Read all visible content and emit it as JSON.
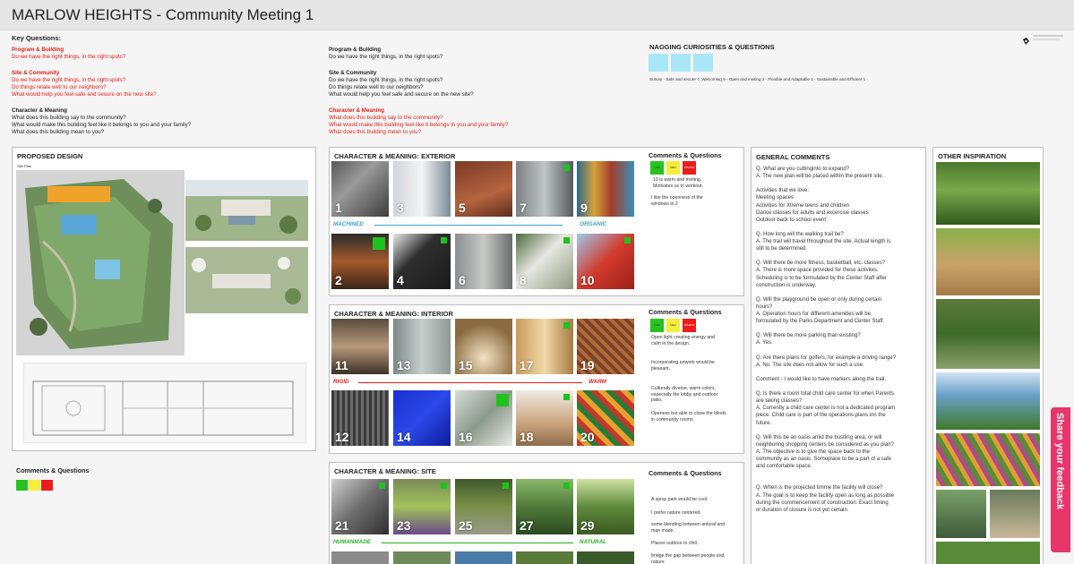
{
  "title": "MARLOW HEIGHTS - Community Meeting 1",
  "key_questions": {
    "heading": "Key Questions:",
    "program_heading": "Program & Building",
    "program_q": "Do we have the right things, in the right spots?",
    "site_heading": "Site & Community",
    "site_q1": "Do we have the right things, in the right spots?",
    "site_q2": "Do things relate well to our neighbors?",
    "site_q3": "What would help you feel safe and secure on the new site?",
    "char_heading": "Character & Meaning",
    "char_q1": "What does this building say to the community?",
    "char_q2": "What would make this building feel like it belongs to you and your family?",
    "char_q3": "What does this building mean to you?"
  },
  "nagging": {
    "heading": "NAGGING CURIOSITIES & QUESTIONS",
    "survey": "Survey - Safe and secure 7, Welcoming 5 - Open and inviting 2 - Flexible and Adaptable 1 - Sustainable and Efficient 1 -"
  },
  "proposed": {
    "heading": "PROPOSED DESIGN",
    "sublabel": "Site Plan",
    "comments_heading": "Comments & Questions"
  },
  "exterior": {
    "heading": "CHARACTER & MEANING: EXTERIOR",
    "left_label": "MACHINED",
    "right_label": "ORGANIC",
    "numbers": [
      "1",
      "3",
      "5",
      "7",
      "9",
      "2",
      "4",
      "6",
      "8",
      "10"
    ],
    "cq_heading": "Comments & Questions",
    "vote_labels": [
      "LIKE",
      "MEH",
      "DISLIKE"
    ],
    "comments": [
      "10 is warm and inviting. Motivates us to workout.",
      "I like the openness of the windows in 2"
    ]
  },
  "interior": {
    "heading": "CHARACTER & MEANING: INTERIOR",
    "left_label": "RIGID",
    "right_label": "WARM",
    "numbers": [
      "11",
      "13",
      "15",
      "17",
      "19",
      "12",
      "14",
      "16",
      "18",
      "20"
    ],
    "cq_heading": "Comments & Questions",
    "vote_labels": [
      "LIKE",
      "MEH",
      "DISLIKE"
    ],
    "comments": [
      "Open light creating energy and calm in the design.",
      "Incorporating artwork would be pleasant.",
      "Culturally diverse, warm colors, especially the lobby and outdoor patio.",
      "Openess but able to close the blinds in community rooms."
    ]
  },
  "site": {
    "heading": "CHARACTER & MEANING: SITE",
    "left_label": "HUMANMADE",
    "right_label": "NATURAL",
    "numbers": [
      "21",
      "23",
      "25",
      "27",
      "29"
    ],
    "cq_heading": "Comments & Questions",
    "comments": [
      "A spray park would be cool.",
      "I prefer nature centered.",
      "some blending between antural and man made.",
      "Places outdoor to chill.",
      "bridge the gap between people and nature"
    ]
  },
  "general": {
    "heading": "GENERAL COMMENTS",
    "lines": [
      "Q. What are you cuttinginto to expand?",
      "A.  The new plan will be placed within the present site.",
      "",
      "Activities that we love:",
      "Meeting spaces",
      "Activities for Xtreme teens and children",
      "Dance classes for adults and excercise classes",
      "Outdoor back to school event",
      "",
      "Q. How long will the walking trail be?",
      "A. The trail will travel throughout the site.  Actual length is",
      "still to be determined.",
      "",
      "Q. Will there be more fitness, basketball, etc. classes?",
      "A.  There is more space provided for these activites.",
      "  Scheduling is to be formulated by the Center Staff after",
      "construction is underway.",
      "",
      "Q.  Will the playground be open or only during certain",
      "hours?",
      "A.  Operation hours for different amenities will be",
      "formulated by the Parks Department and Center Staff.",
      "",
      "Q. Will there be more parking than existing?",
      "A. Yes.",
      "",
      "Q.  Are there plans for golfers, for example a driving range?",
      "A. No.  The site does not allow for such a use.",
      "",
      "Comment - I would like to have markers along the trail.",
      "",
      "Q. Is there a room total child care center for when Parents",
      "are taking classes?",
      "A. Currently a child care center is not a dedicated program",
      "piece.  Child care is part of the operations plans inn the",
      "future.",
      "",
      "Q. Will this be an oasis amid the bustling area, or will",
      "neighboring shopping centers be considered as you plan?",
      "A. The objective is to give the space back to the",
      "community as an oasis.  Someplace to be a part of a safe",
      "and comfortable space.",
      "",
      "",
      "Q. When is the projected timme the facility will close?",
      "A. The goal is to keep the facility open as long as possible",
      "during the commencement of construction.  Exact timing",
      "or duration of closure is not yet certain."
    ]
  },
  "inspiration": {
    "heading": "OTHER INSPIRATION"
  },
  "feedback": "Share your feedback",
  "colors": {
    "red": "#e0201b",
    "like": "#27c21f",
    "meh": "#f2ee3a",
    "dislike": "#ea1c1c",
    "feedback": "#e8356b"
  }
}
